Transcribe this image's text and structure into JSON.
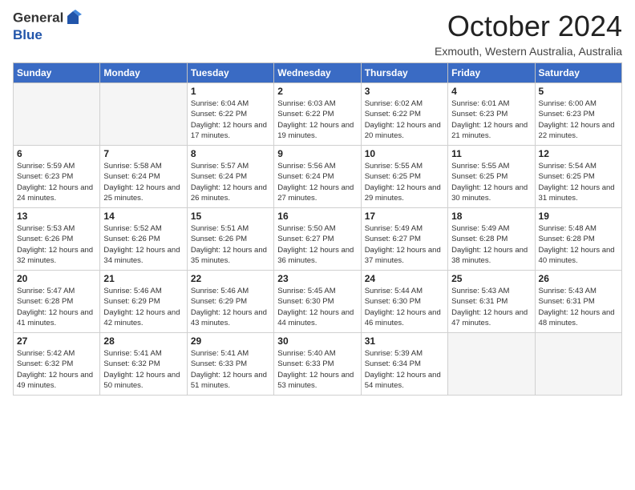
{
  "header": {
    "logo_general": "General",
    "logo_blue": "Blue",
    "month": "October 2024",
    "location": "Exmouth, Western Australia, Australia"
  },
  "days_of_week": [
    "Sunday",
    "Monday",
    "Tuesday",
    "Wednesday",
    "Thursday",
    "Friday",
    "Saturday"
  ],
  "weeks": [
    [
      {
        "day": "",
        "info": ""
      },
      {
        "day": "",
        "info": ""
      },
      {
        "day": "1",
        "info": "Sunrise: 6:04 AM\nSunset: 6:22 PM\nDaylight: 12 hours and 17 minutes."
      },
      {
        "day": "2",
        "info": "Sunrise: 6:03 AM\nSunset: 6:22 PM\nDaylight: 12 hours and 19 minutes."
      },
      {
        "day": "3",
        "info": "Sunrise: 6:02 AM\nSunset: 6:22 PM\nDaylight: 12 hours and 20 minutes."
      },
      {
        "day": "4",
        "info": "Sunrise: 6:01 AM\nSunset: 6:23 PM\nDaylight: 12 hours and 21 minutes."
      },
      {
        "day": "5",
        "info": "Sunrise: 6:00 AM\nSunset: 6:23 PM\nDaylight: 12 hours and 22 minutes."
      }
    ],
    [
      {
        "day": "6",
        "info": "Sunrise: 5:59 AM\nSunset: 6:23 PM\nDaylight: 12 hours and 24 minutes."
      },
      {
        "day": "7",
        "info": "Sunrise: 5:58 AM\nSunset: 6:24 PM\nDaylight: 12 hours and 25 minutes."
      },
      {
        "day": "8",
        "info": "Sunrise: 5:57 AM\nSunset: 6:24 PM\nDaylight: 12 hours and 26 minutes."
      },
      {
        "day": "9",
        "info": "Sunrise: 5:56 AM\nSunset: 6:24 PM\nDaylight: 12 hours and 27 minutes."
      },
      {
        "day": "10",
        "info": "Sunrise: 5:55 AM\nSunset: 6:25 PM\nDaylight: 12 hours and 29 minutes."
      },
      {
        "day": "11",
        "info": "Sunrise: 5:55 AM\nSunset: 6:25 PM\nDaylight: 12 hours and 30 minutes."
      },
      {
        "day": "12",
        "info": "Sunrise: 5:54 AM\nSunset: 6:25 PM\nDaylight: 12 hours and 31 minutes."
      }
    ],
    [
      {
        "day": "13",
        "info": "Sunrise: 5:53 AM\nSunset: 6:26 PM\nDaylight: 12 hours and 32 minutes."
      },
      {
        "day": "14",
        "info": "Sunrise: 5:52 AM\nSunset: 6:26 PM\nDaylight: 12 hours and 34 minutes."
      },
      {
        "day": "15",
        "info": "Sunrise: 5:51 AM\nSunset: 6:26 PM\nDaylight: 12 hours and 35 minutes."
      },
      {
        "day": "16",
        "info": "Sunrise: 5:50 AM\nSunset: 6:27 PM\nDaylight: 12 hours and 36 minutes."
      },
      {
        "day": "17",
        "info": "Sunrise: 5:49 AM\nSunset: 6:27 PM\nDaylight: 12 hours and 37 minutes."
      },
      {
        "day": "18",
        "info": "Sunrise: 5:49 AM\nSunset: 6:28 PM\nDaylight: 12 hours and 38 minutes."
      },
      {
        "day": "19",
        "info": "Sunrise: 5:48 AM\nSunset: 6:28 PM\nDaylight: 12 hours and 40 minutes."
      }
    ],
    [
      {
        "day": "20",
        "info": "Sunrise: 5:47 AM\nSunset: 6:28 PM\nDaylight: 12 hours and 41 minutes."
      },
      {
        "day": "21",
        "info": "Sunrise: 5:46 AM\nSunset: 6:29 PM\nDaylight: 12 hours and 42 minutes."
      },
      {
        "day": "22",
        "info": "Sunrise: 5:46 AM\nSunset: 6:29 PM\nDaylight: 12 hours and 43 minutes."
      },
      {
        "day": "23",
        "info": "Sunrise: 5:45 AM\nSunset: 6:30 PM\nDaylight: 12 hours and 44 minutes."
      },
      {
        "day": "24",
        "info": "Sunrise: 5:44 AM\nSunset: 6:30 PM\nDaylight: 12 hours and 46 minutes."
      },
      {
        "day": "25",
        "info": "Sunrise: 5:43 AM\nSunset: 6:31 PM\nDaylight: 12 hours and 47 minutes."
      },
      {
        "day": "26",
        "info": "Sunrise: 5:43 AM\nSunset: 6:31 PM\nDaylight: 12 hours and 48 minutes."
      }
    ],
    [
      {
        "day": "27",
        "info": "Sunrise: 5:42 AM\nSunset: 6:32 PM\nDaylight: 12 hours and 49 minutes."
      },
      {
        "day": "28",
        "info": "Sunrise: 5:41 AM\nSunset: 6:32 PM\nDaylight: 12 hours and 50 minutes."
      },
      {
        "day": "29",
        "info": "Sunrise: 5:41 AM\nSunset: 6:33 PM\nDaylight: 12 hours and 51 minutes."
      },
      {
        "day": "30",
        "info": "Sunrise: 5:40 AM\nSunset: 6:33 PM\nDaylight: 12 hours and 53 minutes."
      },
      {
        "day": "31",
        "info": "Sunrise: 5:39 AM\nSunset: 6:34 PM\nDaylight: 12 hours and 54 minutes."
      },
      {
        "day": "",
        "info": ""
      },
      {
        "day": "",
        "info": ""
      }
    ]
  ]
}
